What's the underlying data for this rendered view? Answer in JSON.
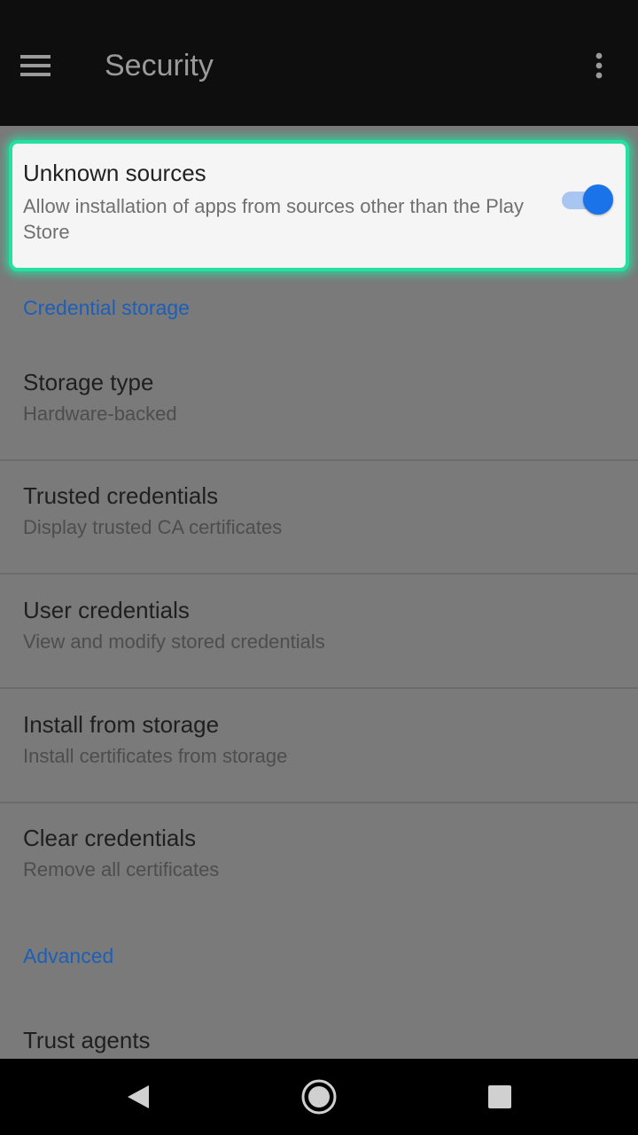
{
  "appbar": {
    "title": "Security",
    "menu_icon": "hamburger-menu-icon",
    "overflow_icon": "more-vert-icon"
  },
  "highlight_row": {
    "title": "Unknown sources",
    "summary": "Allow installation of apps from sources other than the Play Store",
    "toggle_on": true
  },
  "sections": [
    {
      "header": "Credential storage",
      "items": [
        {
          "title": "Storage type",
          "summary": "Hardware-backed"
        },
        {
          "title": "Trusted credentials",
          "summary": "Display trusted CA certificates"
        },
        {
          "title": "User credentials",
          "summary": "View and modify stored credentials"
        },
        {
          "title": "Install from storage",
          "summary": "Install certificates from storage"
        },
        {
          "title": "Clear credentials",
          "summary": "Remove all certificates"
        }
      ]
    },
    {
      "header": "Advanced",
      "items": [
        {
          "title": "Trust agents"
        }
      ]
    }
  ],
  "navbar": {
    "back_icon": "back-triangle-icon",
    "home_icon": "home-circle-icon",
    "recents_icon": "recents-square-icon"
  },
  "colors": {
    "accent": "#1a73e8",
    "highlight_border": "#25e0a0",
    "section_header": "#1d5fb8",
    "scrim_background": "#7a7a7a"
  }
}
